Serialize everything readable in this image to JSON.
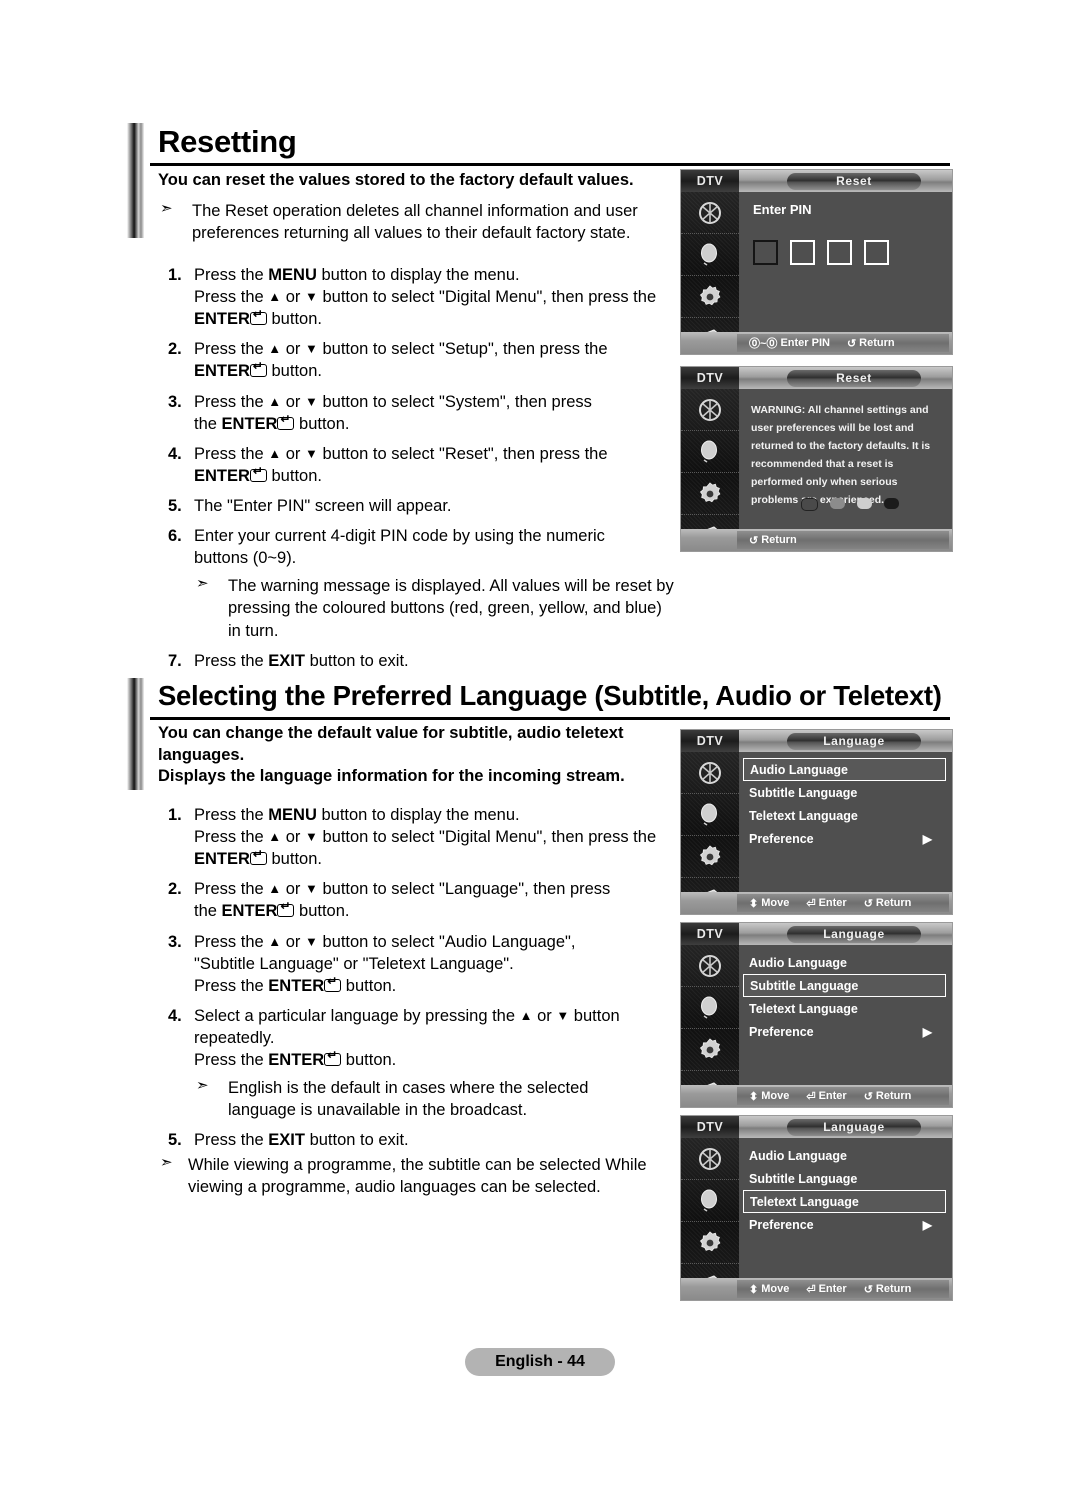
{
  "sections": [
    {
      "title": "Resetting",
      "lead": "You can reset the values stored to the factory default values.",
      "intro_note": "The Reset operation deletes all channel information and user preferences returning all values to their default factory state.",
      "steps": [
        {
          "num": "1.",
          "lines": [
            "Press the |MENU| button to display the menu.",
            "Press the ▲ or ▼ button to select \"Digital Menu\", then press the",
            "|ENTER|@ button."
          ]
        },
        {
          "num": "2.",
          "lines": [
            "Press the ▲ or ▼ button to select \"Setup\", then press the",
            "|ENTER|@ button."
          ]
        },
        {
          "num": "3.",
          "lines": [
            "Press the ▲ or ▼ button to select \"System\", then press",
            "the |ENTER|@ button."
          ]
        },
        {
          "num": "4.",
          "lines": [
            "Press the ▲ or ▼ button to select \"Reset\", then press the",
            "|ENTER|@ button."
          ]
        },
        {
          "num": "5.",
          "lines": [
            "The \"Enter PIN\" screen will appear."
          ]
        },
        {
          "num": "6.",
          "lines": [
            "Enter your current 4-digit PIN code by using the numeric",
            "buttons (0~9)."
          ],
          "note": "The warning message is displayed. All values will be reset by pressing the coloured buttons (red, green, yellow, and blue) in turn."
        },
        {
          "num": "7.",
          "lines": [
            "Press the |EXIT| button to exit."
          ]
        }
      ]
    },
    {
      "title": "Selecting the Preferred Language (Subtitle, Audio or Teletext)",
      "lead": "You can change the default value for subtitle, audio teletext languages.",
      "lead2": "Displays the language information for the incoming stream.",
      "steps": [
        {
          "num": "1.",
          "lines": [
            "Press the |MENU| button to display the menu.",
            "Press the ▲ or ▼ button to select \"Digital Menu\", then press the",
            "|ENTER|@ button."
          ]
        },
        {
          "num": "2.",
          "lines": [
            "Press the ▲ or ▼ button to select \"Language\", then press",
            "the |ENTER|@ button."
          ]
        },
        {
          "num": "3.",
          "lines": [
            "Press the ▲ or ▼ button to select \"Audio Language\",",
            "\"Subtitle Language\" or \"Teletext Language\".",
            "Press the |ENTER|@ button."
          ]
        },
        {
          "num": "4.",
          "lines": [
            "Select a particular language by pressing the ▲ or ▼ button",
            "repeatedly.",
            "Press the |ENTER|@ button."
          ],
          "note": "English is the default in cases where the selected language is unavailable in the broadcast."
        },
        {
          "num": "5.",
          "lines": [
            "Press the |EXIT| button to exit."
          ]
        }
      ],
      "final_note": "While viewing a programme, the subtitle can be selected While viewing a programme, audio languages can be selected."
    }
  ],
  "osd_screens": [
    {
      "id": "reset-pin",
      "source_label": "DTV",
      "title": "Reset",
      "content_label": "Enter PIN",
      "pin_boxes": 4,
      "bottom_items": [
        {
          "icon": "numeric-keys-icon",
          "glyph": "⓪~⓪",
          "label": "Enter PIN"
        },
        {
          "icon": "return-icon",
          "glyph": "↺",
          "label": "Return"
        }
      ]
    },
    {
      "id": "reset-warning",
      "source_label": "DTV",
      "title": "Reset",
      "warning": "WARNING: All channel settings and user preferences will be lost and returned to the factory defaults. It is recommended that a reset is performed only when serious problems are experienced.",
      "colour_buttons": [
        {
          "name": "red",
          "shade": "#4a4a4a"
        },
        {
          "name": "green",
          "shade": "#8c8c8c"
        },
        {
          "name": "yellow",
          "shade": "#cfcfcf"
        },
        {
          "name": "blue",
          "shade": "#1b1b1b"
        }
      ],
      "bottom_items": [
        {
          "icon": "return-icon",
          "glyph": "↺",
          "label": "Return"
        }
      ]
    },
    {
      "id": "language-audio",
      "source_label": "DTV",
      "title": "Language",
      "menu_items": [
        {
          "label": "Audio Language",
          "selected": true,
          "arrow": false
        },
        {
          "label": "Subtitle Language",
          "selected": false,
          "arrow": false
        },
        {
          "label": "Teletext Language",
          "selected": false,
          "arrow": false
        },
        {
          "label": "Preference",
          "selected": false,
          "arrow": true
        }
      ],
      "bottom_items": [
        {
          "icon": "move-icon",
          "glyph": "⬍",
          "label": "Move"
        },
        {
          "icon": "enter-icon",
          "glyph": "⏎",
          "label": "Enter"
        },
        {
          "icon": "return-icon",
          "glyph": "↺",
          "label": "Return"
        }
      ]
    },
    {
      "id": "language-subtitle",
      "source_label": "DTV",
      "title": "Language",
      "menu_items": [
        {
          "label": "Audio Language",
          "selected": false,
          "arrow": false
        },
        {
          "label": "Subtitle Language",
          "selected": true,
          "arrow": false
        },
        {
          "label": "Teletext Language",
          "selected": false,
          "arrow": false
        },
        {
          "label": "Preference",
          "selected": false,
          "arrow": true
        }
      ],
      "bottom_items": [
        {
          "icon": "move-icon",
          "glyph": "⬍",
          "label": "Move"
        },
        {
          "icon": "enter-icon",
          "glyph": "⏎",
          "label": "Enter"
        },
        {
          "icon": "return-icon",
          "glyph": "↺",
          "label": "Return"
        }
      ]
    },
    {
      "id": "language-teletext",
      "source_label": "DTV",
      "title": "Language",
      "menu_items": [
        {
          "label": "Audio Language",
          "selected": false,
          "arrow": false
        },
        {
          "label": "Subtitle Language",
          "selected": false,
          "arrow": false
        },
        {
          "label": "Teletext Language",
          "selected": true,
          "arrow": false
        },
        {
          "label": "Preference",
          "selected": false,
          "arrow": true
        }
      ],
      "bottom_items": [
        {
          "icon": "move-icon",
          "glyph": "⬍",
          "label": "Move"
        },
        {
          "icon": "enter-icon",
          "glyph": "⏎",
          "label": "Enter"
        },
        {
          "icon": "return-icon",
          "glyph": "↺",
          "label": "Return"
        }
      ]
    }
  ],
  "footer": {
    "page_label": "English - 44"
  }
}
